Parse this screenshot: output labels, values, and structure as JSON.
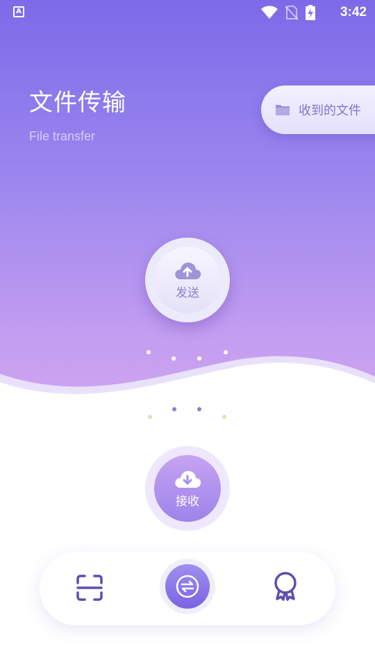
{
  "status_bar": {
    "time": "3:42",
    "left_icon_letter": "A"
  },
  "header": {
    "title": "文件传输",
    "subtitle": "File transfer"
  },
  "received_files": {
    "label": "收到的文件",
    "icon": "folder-icon"
  },
  "send": {
    "label": "发送",
    "icon": "cloud-upload-icon"
  },
  "receive": {
    "label": "接收",
    "icon": "cloud-download-icon"
  },
  "bottom_nav": {
    "items": [
      {
        "name": "scan",
        "icon": "scan-icon"
      },
      {
        "name": "transfer",
        "icon": "swap-arrows-icon",
        "active": true
      },
      {
        "name": "medal",
        "icon": "medal-icon"
      }
    ]
  },
  "colors": {
    "accent": "#7a63e2",
    "gradient_top": "#7d6ae8",
    "gradient_bottom": "#d1a8f2",
    "icon_purple": "#5b4fb0"
  }
}
